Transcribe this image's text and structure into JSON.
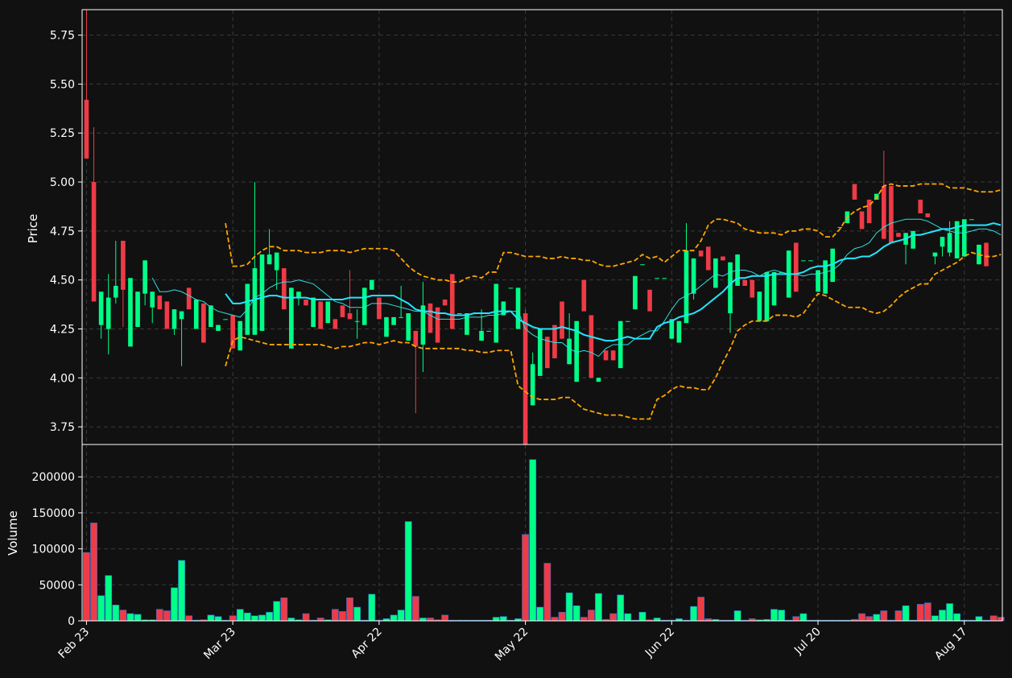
{
  "chart_data": {
    "type": "candlestick",
    "colors": {
      "background": "#111111",
      "up": "#00ff88",
      "down": "#ee3b46",
      "grid": "#3a3a3a",
      "bollinger": "#ffa500",
      "ma_fast": "#33dde0",
      "ma_slow": "#22e6ff",
      "spine": "#ffffff"
    },
    "price_panel": {
      "ylabel": "Price",
      "ylim": [
        3.66,
        5.88
      ],
      "yticks": [
        3.75,
        4.0,
        4.25,
        4.5,
        4.75,
        5.0,
        5.25,
        5.5,
        5.75
      ],
      "ytick_labels": [
        "3.75",
        "4.00",
        "4.25",
        "4.50",
        "4.75",
        "5.00",
        "5.25",
        "5.50",
        "5.75"
      ],
      "grid": true
    },
    "volume_panel": {
      "ylabel": "Volume",
      "ylim": [
        0,
        245000
      ],
      "yticks": [
        0,
        50000,
        100000,
        150000,
        200000
      ],
      "ytick_labels": [
        "0",
        "50000",
        "100000",
        "150000",
        "200000"
      ],
      "grid": true
    },
    "x_axis": {
      "xlim": [
        -0.6,
        125.2
      ],
      "ticks": [
        {
          "index": 0,
          "label": "Feb 23"
        },
        {
          "index": 20,
          "label": "Mar 23"
        },
        {
          "index": 40,
          "label": "Apr 22"
        },
        {
          "index": 60,
          "label": "May 22"
        },
        {
          "index": 80,
          "label": "Jun 22"
        },
        {
          "index": 100,
          "label": "Jul 20"
        },
        {
          "index": 120,
          "label": "Aug 17"
        }
      ]
    },
    "candles": [
      [
        5.42,
        5.88,
        5.12,
        5.12
      ],
      [
        5.0,
        5.28,
        4.39,
        4.39
      ],
      [
        4.27,
        4.44,
        4.2,
        4.44
      ],
      [
        4.25,
        4.53,
        4.12,
        4.41
      ],
      [
        4.41,
        4.7,
        4.38,
        4.47
      ],
      [
        4.7,
        4.7,
        4.26,
        4.45
      ],
      [
        4.16,
        4.51,
        4.16,
        4.51
      ],
      [
        4.26,
        4.44,
        4.26,
        4.44
      ],
      [
        4.43,
        4.6,
        4.37,
        4.6
      ],
      [
        4.36,
        4.44,
        4.28,
        4.44
      ],
      [
        4.42,
        4.42,
        4.35,
        4.35
      ],
      [
        4.39,
        4.39,
        4.25,
        4.25
      ],
      [
        4.25,
        4.35,
        4.22,
        4.35
      ],
      [
        4.3,
        4.34,
        4.06,
        4.34
      ],
      [
        4.46,
        4.46,
        4.35,
        4.35
      ],
      [
        4.25,
        4.4,
        4.25,
        4.4
      ],
      [
        4.38,
        4.38,
        4.18,
        4.18
      ],
      [
        4.26,
        4.37,
        4.26,
        4.37
      ],
      [
        4.24,
        4.27,
        4.24,
        4.27
      ],
      [
        4.3,
        4.3,
        4.3,
        4.3
      ],
      [
        4.32,
        4.32,
        4.15,
        4.15
      ],
      [
        4.14,
        4.29,
        4.14,
        4.29
      ],
      [
        4.22,
        4.48,
        4.22,
        4.48
      ],
      [
        4.22,
        5.0,
        4.22,
        4.56
      ],
      [
        4.24,
        4.63,
        4.24,
        4.63
      ],
      [
        4.58,
        4.76,
        4.58,
        4.63
      ],
      [
        4.55,
        4.64,
        4.45,
        4.64
      ],
      [
        4.56,
        4.56,
        4.35,
        4.35
      ],
      [
        4.15,
        4.46,
        4.15,
        4.46
      ],
      [
        4.41,
        4.44,
        4.37,
        4.44
      ],
      [
        4.4,
        4.4,
        4.37,
        4.37
      ],
      [
        4.26,
        4.41,
        4.26,
        4.41
      ],
      [
        4.39,
        4.39,
        4.25,
        4.25
      ],
      [
        4.28,
        4.39,
        4.28,
        4.39
      ],
      [
        4.3,
        4.3,
        4.25,
        4.25
      ],
      [
        4.37,
        4.37,
        4.31,
        4.31
      ],
      [
        4.33,
        4.55,
        4.3,
        4.3
      ],
      [
        4.29,
        4.35,
        4.2,
        4.29
      ],
      [
        4.27,
        4.46,
        4.27,
        4.46
      ],
      [
        4.45,
        4.5,
        4.45,
        4.5
      ],
      [
        4.41,
        4.41,
        4.3,
        4.3
      ],
      [
        4.21,
        4.31,
        4.21,
        4.31
      ],
      [
        4.27,
        4.31,
        4.27,
        4.31
      ],
      [
        4.31,
        4.47,
        4.31,
        4.31
      ],
      [
        4.19,
        4.33,
        4.19,
        4.33
      ],
      [
        4.24,
        4.24,
        3.82,
        4.16
      ],
      [
        4.17,
        4.49,
        4.03,
        4.37
      ],
      [
        4.38,
        4.38,
        4.23,
        4.23
      ],
      [
        4.36,
        4.36,
        4.18,
        4.18
      ],
      [
        4.4,
        4.4,
        4.37,
        4.37
      ],
      [
        4.53,
        4.53,
        4.25,
        4.25
      ],
      [
        4.33,
        4.33,
        4.33,
        4.33
      ],
      [
        4.22,
        4.33,
        4.22,
        4.33
      ],
      [
        4.33,
        4.33,
        4.33,
        4.33
      ],
      [
        4.19,
        4.35,
        4.19,
        4.24
      ],
      [
        4.24,
        4.24,
        4.24,
        4.24
      ],
      [
        4.18,
        4.48,
        4.18,
        4.48
      ],
      [
        4.32,
        4.39,
        4.32,
        4.39
      ],
      [
        4.46,
        4.46,
        4.46,
        4.46
      ],
      [
        4.25,
        4.46,
        4.25,
        4.46
      ],
      [
        4.33,
        4.35,
        3.66,
        3.66
      ],
      [
        3.86,
        4.13,
        3.86,
        4.07
      ],
      [
        4.01,
        4.25,
        4.01,
        4.25
      ],
      [
        4.21,
        4.21,
        4.05,
        4.05
      ],
      [
        4.27,
        4.27,
        4.1,
        4.1
      ],
      [
        4.39,
        4.39,
        4.2,
        4.2
      ],
      [
        4.07,
        4.33,
        4.07,
        4.2
      ],
      [
        3.98,
        4.29,
        3.98,
        4.29
      ],
      [
        4.5,
        4.5,
        4.34,
        4.34
      ],
      [
        4.32,
        4.32,
        4.0,
        4.0
      ],
      [
        3.98,
        4.0,
        3.98,
        4.0
      ],
      [
        4.14,
        4.14,
        4.09,
        4.09
      ],
      [
        4.14,
        4.14,
        4.09,
        4.09
      ],
      [
        4.05,
        4.29,
        4.05,
        4.29
      ],
      [
        4.29,
        4.29,
        4.29,
        4.29
      ],
      [
        4.35,
        4.52,
        4.35,
        4.52
      ],
      [
        4.58,
        4.58,
        4.58,
        4.58
      ],
      [
        4.45,
        4.45,
        4.34,
        4.34
      ],
      [
        4.51,
        4.51,
        4.51,
        4.51
      ],
      [
        4.51,
        4.51,
        4.51,
        4.51
      ],
      [
        4.2,
        4.3,
        4.2,
        4.3
      ],
      [
        4.18,
        4.29,
        4.18,
        4.29
      ],
      [
        4.28,
        4.79,
        4.28,
        4.65
      ],
      [
        4.43,
        4.61,
        4.4,
        4.61
      ],
      [
        4.65,
        4.65,
        4.62,
        4.62
      ],
      [
        4.67,
        4.67,
        4.55,
        4.55
      ],
      [
        4.46,
        4.61,
        4.46,
        4.61
      ],
      [
        4.62,
        4.62,
        4.6,
        4.6
      ],
      [
        4.33,
        4.59,
        4.23,
        4.59
      ],
      [
        4.47,
        4.63,
        4.47,
        4.63
      ],
      [
        4.5,
        4.5,
        4.47,
        4.47
      ],
      [
        4.5,
        4.5,
        4.41,
        4.41
      ],
      [
        4.29,
        4.44,
        4.29,
        4.44
      ],
      [
        4.29,
        4.54,
        4.29,
        4.54
      ],
      [
        4.37,
        4.54,
        4.37,
        4.54
      ],
      [
        4.54,
        4.54,
        4.54,
        4.54
      ],
      [
        4.41,
        4.65,
        4.41,
        4.65
      ],
      [
        4.69,
        4.69,
        4.44,
        4.44
      ],
      [
        4.6,
        4.6,
        4.6,
        4.6
      ],
      [
        4.6,
        4.6,
        4.6,
        4.6
      ],
      [
        4.44,
        4.55,
        4.44,
        4.55
      ],
      [
        4.43,
        4.6,
        4.43,
        4.6
      ],
      [
        4.49,
        4.66,
        4.49,
        4.66
      ],
      [
        4.77,
        4.77,
        4.77,
        4.77
      ],
      [
        4.79,
        4.85,
        4.79,
        4.85
      ],
      [
        4.99,
        4.99,
        4.91,
        4.91
      ],
      [
        4.85,
        4.85,
        4.76,
        4.76
      ],
      [
        4.91,
        4.91,
        4.79,
        4.79
      ],
      [
        4.91,
        4.94,
        4.91,
        4.94
      ],
      [
        4.98,
        5.16,
        4.71,
        4.71
      ],
      [
        4.98,
        4.98,
        4.69,
        4.69
      ],
      [
        4.74,
        4.74,
        4.72,
        4.72
      ],
      [
        4.68,
        4.74,
        4.58,
        4.74
      ],
      [
        4.66,
        4.75,
        4.66,
        4.75
      ],
      [
        4.91,
        4.91,
        4.84,
        4.84
      ],
      [
        4.84,
        4.84,
        4.82,
        4.82
      ],
      [
        4.62,
        4.64,
        4.58,
        4.64
      ],
      [
        4.67,
        4.72,
        4.62,
        4.72
      ],
      [
        4.64,
        4.8,
        4.62,
        4.74
      ],
      [
        4.61,
        4.8,
        4.61,
        4.8
      ],
      [
        4.62,
        4.81,
        4.62,
        4.81
      ],
      [
        4.81,
        4.81,
        4.81,
        4.81
      ],
      [
        4.58,
        4.68,
        4.58,
        4.68
      ],
      [
        4.69,
        4.69,
        4.57,
        4.57
      ]
    ],
    "volumes": [
      95000,
      136000,
      35000,
      63000,
      22000,
      15000,
      10000,
      9000,
      1500,
      1500,
      16000,
      14000,
      46000,
      84000,
      7000,
      1000,
      1500,
      8000,
      6000,
      1000,
      7000,
      16000,
      11000,
      7000,
      8000,
      12000,
      27000,
      32000,
      4000,
      1500,
      10000,
      1000,
      4000,
      1500,
      16000,
      13000,
      32000,
      19000,
      1000,
      37000,
      1000,
      3000,
      8000,
      15000,
      138000,
      34000,
      4000,
      4000,
      1500,
      8000,
      1000,
      1000,
      1000,
      1000,
      1000,
      1000,
      5000,
      6000,
      1000,
      3000,
      120000,
      224000,
      19000,
      80000,
      5000,
      12000,
      39000,
      21000,
      5000,
      15000,
      38000,
      2000,
      10000,
      36000,
      10000,
      1000,
      12000,
      1500,
      4000,
      1000,
      1000,
      3000,
      1000,
      20000,
      33000,
      3000,
      2000,
      1000,
      1000,
      14000,
      1000,
      3000,
      1500,
      2000,
      16000,
      15000,
      1000,
      6000,
      10000,
      1000,
      1000,
      1000,
      1000,
      1000,
      1000,
      2000,
      10000,
      6000,
      9000,
      14000,
      1000,
      14000,
      21000,
      1000,
      23000,
      25000,
      7000,
      15000,
      24000,
      10000,
      1000,
      1000,
      6000,
      1000,
      7000,
      5000
    ],
    "bollinger_upper": [
      null,
      null,
      null,
      null,
      null,
      null,
      null,
      null,
      null,
      null,
      null,
      null,
      null,
      null,
      null,
      null,
      null,
      null,
      null,
      4.79,
      4.57,
      4.57,
      4.58,
      4.62,
      4.65,
      4.67,
      4.67,
      4.65,
      4.65,
      4.65,
      4.64,
      4.64,
      4.64,
      4.65,
      4.65,
      4.65,
      4.64,
      4.65,
      4.66,
      4.66,
      4.66,
      4.66,
      4.65,
      4.61,
      4.57,
      4.54,
      4.52,
      4.51,
      4.5,
      4.5,
      4.49,
      4.49,
      4.51,
      4.52,
      4.51,
      4.54,
      4.54,
      4.64,
      4.64,
      4.63,
      4.62,
      4.62,
      4.62,
      4.61,
      4.61,
      4.62,
      4.61,
      4.61,
      4.6,
      4.6,
      4.58,
      4.57,
      4.57,
      4.58,
      4.59,
      4.6,
      4.63,
      4.61,
      4.62,
      4.59,
      4.62,
      4.65,
      4.65,
      4.65,
      4.7,
      4.78,
      4.81,
      4.81,
      4.8,
      4.79,
      4.76,
      4.75,
      4.74,
      4.74,
      4.74,
      4.73,
      4.75,
      4.75,
      4.76,
      4.76,
      4.75,
      4.72,
      4.72,
      4.76,
      4.82,
      4.85,
      4.87,
      4.88,
      4.92,
      4.98,
      4.99,
      4.98,
      4.98,
      4.98,
      4.99,
      4.99,
      4.99,
      4.99,
      4.97,
      4.97,
      4.97,
      4.96,
      4.95,
      4.95,
      4.95,
      4.96
    ],
    "bollinger_lower": [
      null,
      null,
      null,
      null,
      null,
      null,
      null,
      null,
      null,
      null,
      null,
      null,
      null,
      null,
      null,
      null,
      null,
      null,
      null,
      4.06,
      4.19,
      4.21,
      4.2,
      4.19,
      4.18,
      4.17,
      4.17,
      4.17,
      4.17,
      4.17,
      4.17,
      4.17,
      4.17,
      4.16,
      4.15,
      4.16,
      4.16,
      4.17,
      4.18,
      4.18,
      4.17,
      4.18,
      4.19,
      4.18,
      4.18,
      4.16,
      4.15,
      4.15,
      4.15,
      4.15,
      4.15,
      4.15,
      4.14,
      4.14,
      4.13,
      4.13,
      4.14,
      4.14,
      4.14,
      3.96,
      3.93,
      3.9,
      3.89,
      3.89,
      3.89,
      3.9,
      3.9,
      3.87,
      3.84,
      3.83,
      3.82,
      3.81,
      3.81,
      3.81,
      3.8,
      3.79,
      3.79,
      3.79,
      3.89,
      3.91,
      3.94,
      3.96,
      3.95,
      3.95,
      3.94,
      3.94,
      4.0,
      4.08,
      4.15,
      4.24,
      4.27,
      4.29,
      4.29,
      4.29,
      4.32,
      4.32,
      4.32,
      4.31,
      4.33,
      4.38,
      4.43,
      4.42,
      4.4,
      4.38,
      4.36,
      4.36,
      4.36,
      4.34,
      4.33,
      4.34,
      4.37,
      4.41,
      4.44,
      4.46,
      4.48,
      4.48,
      4.53,
      4.55,
      4.57,
      4.59,
      4.62,
      4.64,
      4.63,
      4.62,
      4.62,
      4.63
    ],
    "ma_fast": [
      null,
      null,
      null,
      null,
      null,
      null,
      null,
      null,
      null,
      4.51,
      4.44,
      4.44,
      4.45,
      4.44,
      4.42,
      4.4,
      4.39,
      4.36,
      4.34,
      4.33,
      4.32,
      4.31,
      4.35,
      4.41,
      4.43,
      4.46,
      4.48,
      4.49,
      4.49,
      4.5,
      4.49,
      4.48,
      4.45,
      4.42,
      4.39,
      4.38,
      4.36,
      4.36,
      4.36,
      4.38,
      4.38,
      4.38,
      4.37,
      4.36,
      4.35,
      4.34,
      4.34,
      4.32,
      4.3,
      4.3,
      4.3,
      4.3,
      4.31,
      4.31,
      4.31,
      4.32,
      4.32,
      4.33,
      4.34,
      4.34,
      4.25,
      4.22,
      4.2,
      4.19,
      4.18,
      4.18,
      4.15,
      4.13,
      4.14,
      4.13,
      4.11,
      4.15,
      4.17,
      4.17,
      4.17,
      4.2,
      4.22,
      4.24,
      4.24,
      4.29,
      4.35,
      4.4,
      4.42,
      4.44,
      4.47,
      4.5,
      4.53,
      4.52,
      4.54,
      4.55,
      4.55,
      4.54,
      4.52,
      4.54,
      4.55,
      4.54,
      4.53,
      4.53,
      4.52,
      4.53,
      4.53,
      4.54,
      4.55,
      4.58,
      4.63,
      4.66,
      4.67,
      4.69,
      4.74,
      4.77,
      4.79,
      4.8,
      4.81,
      4.81,
      4.81,
      4.8,
      4.78,
      4.76,
      4.75,
      4.74,
      4.74,
      4.75,
      4.76,
      4.76,
      4.75,
      4.73
    ],
    "ma_slow": [
      null,
      null,
      null,
      null,
      null,
      null,
      null,
      null,
      null,
      null,
      null,
      null,
      null,
      null,
      null,
      null,
      null,
      null,
      null,
      4.43,
      4.38,
      4.38,
      4.39,
      4.4,
      4.41,
      4.42,
      4.42,
      4.41,
      4.41,
      4.41,
      4.41,
      4.4,
      4.4,
      4.4,
      4.4,
      4.4,
      4.41,
      4.41,
      4.41,
      4.42,
      4.42,
      4.42,
      4.42,
      4.4,
      4.38,
      4.35,
      4.34,
      4.34,
      4.33,
      4.33,
      4.32,
      4.32,
      4.32,
      4.33,
      4.33,
      4.33,
      4.34,
      4.34,
      4.34,
      4.3,
      4.28,
      4.26,
      4.25,
      4.25,
      4.25,
      4.26,
      4.25,
      4.24,
      4.22,
      4.21,
      4.2,
      4.19,
      4.19,
      4.2,
      4.21,
      4.2,
      4.2,
      4.2,
      4.26,
      4.28,
      4.29,
      4.31,
      4.32,
      4.33,
      4.35,
      4.38,
      4.41,
      4.44,
      4.48,
      4.51,
      4.51,
      4.52,
      4.52,
      4.52,
      4.53,
      4.53,
      4.53,
      4.53,
      4.54,
      4.56,
      4.57,
      4.57,
      4.58,
      4.6,
      4.61,
      4.61,
      4.62,
      4.62,
      4.64,
      4.67,
      4.69,
      4.7,
      4.71,
      4.73,
      4.73,
      4.74,
      4.75,
      4.76,
      4.76,
      4.77,
      4.78,
      4.78,
      4.78,
      4.78,
      4.79,
      4.78
    ]
  }
}
